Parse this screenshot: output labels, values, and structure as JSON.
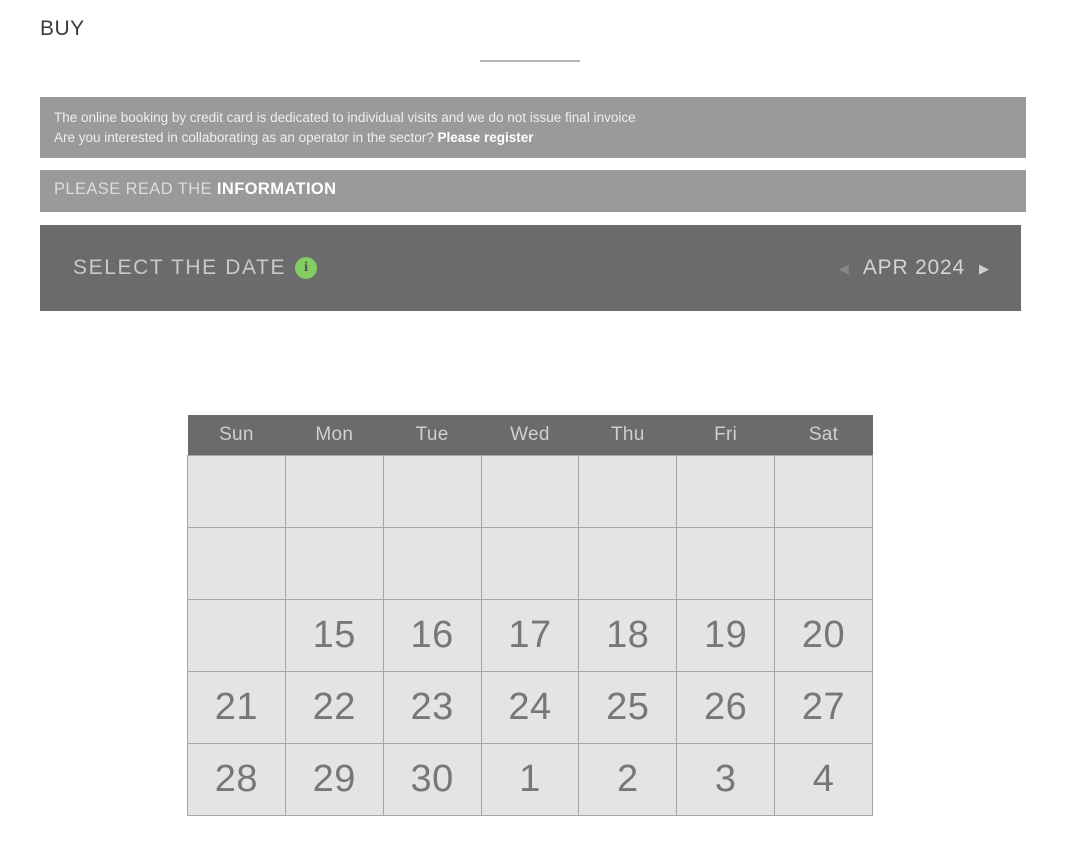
{
  "page": {
    "title": "BUY"
  },
  "notice": {
    "line1": "The online booking by credit card is dedicated to individual visits and we do not issue final invoice",
    "line2_plain": "Are you interested in collaborating as an operator in the sector? ",
    "line2_emphasis": "Please register"
  },
  "information_bar": {
    "prefix": "PLEASE READ THE ",
    "link": "INFORMATION"
  },
  "select_date": {
    "label": "SELECT THE DATE",
    "info_icon_glyph": "i",
    "info_icon_name": "info-circle-icon",
    "prev_arrow": "◀",
    "next_arrow": "▶",
    "month_label": "APR 2024"
  },
  "calendar": {
    "weekdays": [
      "Sun",
      "Mon",
      "Tue",
      "Wed",
      "Thu",
      "Fri",
      "Sat"
    ],
    "weeks": [
      [
        "",
        "",
        "",
        "",
        "",
        "",
        ""
      ],
      [
        "",
        "",
        "",
        "",
        "",
        "",
        ""
      ],
      [
        "",
        "15",
        "16",
        "17",
        "18",
        "19",
        "20"
      ],
      [
        "21",
        "22",
        "23",
        "24",
        "25",
        "26",
        "27"
      ],
      [
        "28",
        "29",
        "30",
        "1",
        "2",
        "3",
        "4"
      ]
    ]
  },
  "colors": {
    "notice_bar": "#9a9a9a",
    "dark_bar": "#6b6b6b",
    "cell_bg": "#e4e4e4",
    "cell_border": "#a6a6a6",
    "accent_green": "#82cc62",
    "day_text": "#777777",
    "title_text": "#3b3b3b"
  }
}
